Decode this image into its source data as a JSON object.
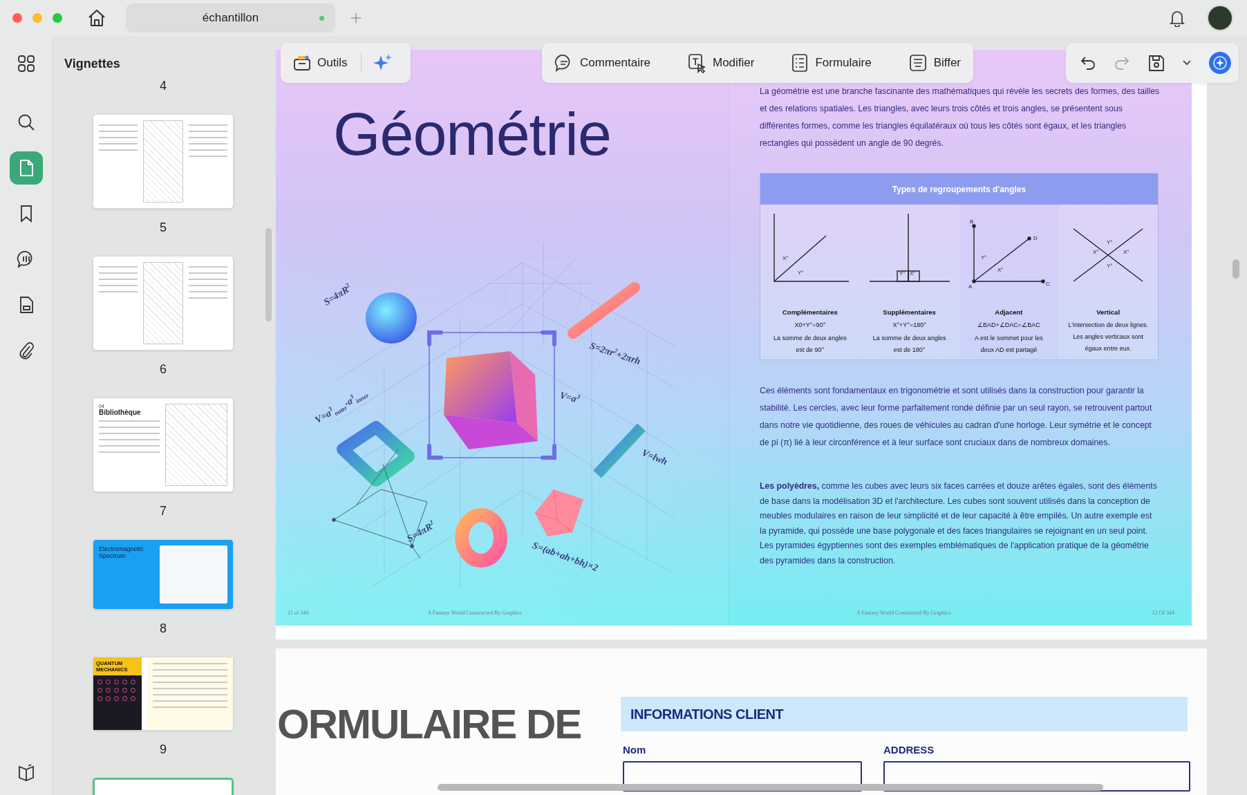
{
  "tab": {
    "title": "échantillon",
    "modified": true
  },
  "rail": [
    {
      "kind": "grid",
      "selected": false
    },
    {
      "kind": "search",
      "selected": false
    },
    {
      "kind": "page",
      "selected": true
    },
    {
      "kind": "bookmark",
      "selected": false
    },
    {
      "kind": "comment",
      "selected": false
    },
    {
      "kind": "document",
      "selected": false
    },
    {
      "kind": "attachment",
      "selected": false
    }
  ],
  "sidebar": {
    "title": "Vignettes",
    "top_label": "4",
    "thumbnails": [
      {
        "kind": "sketch",
        "label": "5",
        "selected": false
      },
      {
        "kind": "sketch",
        "label": "6",
        "selected": false
      },
      {
        "kind": "cover",
        "overline": "04",
        "title": "Bibliothèque",
        "label": "7",
        "selected": false
      },
      {
        "kind": "spectrum",
        "title": "Electromagnetic Spectrum",
        "label": "8",
        "selected": false
      },
      {
        "kind": "quantum",
        "title": "QUANTUM MECHANICS",
        "label": "9",
        "selected": false
      },
      {
        "kind": "partial",
        "selected": true
      }
    ]
  },
  "toolbar": {
    "tools": {
      "label": "Outils"
    },
    "modes": [
      {
        "kind": "comment",
        "label": "Commentaire"
      },
      {
        "kind": "edit",
        "label": "Modifier"
      },
      {
        "kind": "form",
        "label": "Formulaire"
      },
      {
        "kind": "redact",
        "label": "Biffer"
      }
    ],
    "actions": [
      {
        "kind": "undo",
        "disabled": false
      },
      {
        "kind": "redo",
        "disabled": true
      },
      {
        "kind": "save",
        "disabled": false
      },
      {
        "kind": "dropdown",
        "disabled": false
      },
      {
        "kind": "assistant",
        "disabled": false
      }
    ]
  },
  "spread": {
    "left": {
      "title": "Géométrie",
      "formulas": [
        "S=4πR$^{2}$",
        "S=2πr$^{2}$+2πrh",
        "V=a$^{3}$",
        "V=a$^{3}$$_{outer}$-a$^{3}$$_{inner}$",
        "V=lwh",
        "S=4πR$^{2}$",
        "S=(ab+ah+bh)×2"
      ],
      "footer": {
        "page": "11 of 344",
        "credit": "A Fantasy World Constructed By Graphics"
      }
    },
    "right": {
      "intro": "La géométrie est une branche fascinante des mathématiques qui révèle les secrets des formes, des tailles et des relations spatiales. Les triangles, avec leurs trois côtés et trois angles, se présentent sous différentes formes, comme les triangles équilatéraux où tous les côtés sont égaux, et les triangles rectangles qui possèdent un angle de 90 degrés.",
      "table": {
        "title": "Types de regroupements d'angles",
        "columns": [
          {
            "kind": "complementary",
            "labels": [
              "X°",
              "Y°"
            ],
            "title": "Complémentaires",
            "formula": "X0+Y°=90°",
            "description": "La somme de deux angles est de 90°"
          },
          {
            "kind": "supplementary",
            "labels": [
              "Y°",
              "X°"
            ],
            "title": "Supplémentaires",
            "formula": "X°+Y°=180°",
            "description": "La somme de deux angles est de 180°"
          },
          {
            "kind": "adjacent",
            "labels": [
              "B",
              "D",
              "Y°",
              "X°",
              "A",
              "C"
            ],
            "title": "Adjacent",
            "formula": "∠BAD+∠DAC=∠BAC",
            "description": "A est le sommet pour les deux AD est partagé"
          },
          {
            "kind": "vertical",
            "labels": [
              "Y°",
              "X°",
              "X°",
              "Y°"
            ],
            "title": "Vertical",
            "description": "L'intersection de deux lignes. Les angles verticaux sont égaux entre eux."
          }
        ]
      },
      "paragraphs": [
        "Ces éléments sont fondamentaux en trigonométrie et sont utilisés dans la construction pour garantir la stabilité. Les cercles, avec leur forme parfaitement ronde définie par un seul rayon, se retrouvent partout dans notre vie quotidienne, des roues de véhicules au cadran d'une horloge. Leur symétrie et le concept de pi (π) lié à leur circonférence et à leur surface sont cruciaux dans de nombreux domaines.",
        "**Les polyèdres,** comme les cubes avec leurs six faces carrées et douze arêtes égales, sont des éléments de base dans la modélisation 3D et l'architecture. Les cubes sont souvent utilisés dans la conception de meubles modulaires en raison de leur simplicité et de leur capacité à être empilés. Un autre exemple est la pyramide, qui possède une base polygonale et des faces triangulaires se rejoignant en un seul point. Les pyramides égyptiennes sont des exemples emblématiques de l'application pratique de la géométrie des pyramides dans la construction."
      ],
      "footer": {
        "credit": "A Fantasy World Constructed By Graphics",
        "page": "12 Of 344"
      }
    }
  },
  "next_page": {
    "title": "ORMULAIRE DE",
    "section": "INFORMATIONS CLIENT",
    "fields": [
      {
        "label": "Nom"
      },
      {
        "label": "ADDRESS"
      }
    ]
  }
}
